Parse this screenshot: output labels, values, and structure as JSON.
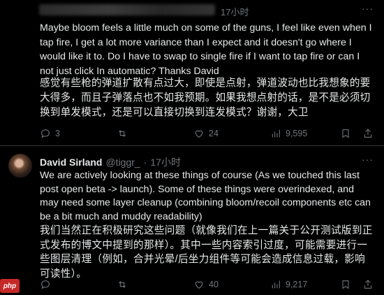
{
  "post1": {
    "time": "17小时",
    "more_icon": "more-icon",
    "text_en": "Maybe bloom feels a little much on some of the guns, I feel like even when I tap fire, I get a lot more variance than I expect and it doesn't go where I would like it to. Do I have to swap to single fire if I want to tap fire or can I not just click   In automatic? Thanks David",
    "text_zh": "感觉有些枪的弹道扩散有点过大，即使是点射，弹道波动也比我想象的要大得多，而且子弹落点也不如我预期。如果我想点射的话，是不是必须切换到单发模式，还是可以直接切换到连发模式？谢谢，大卫",
    "actions": {
      "reply_count": "3",
      "repost_count": "",
      "like_count": "24",
      "views_count": "9,595"
    }
  },
  "post2": {
    "author_name": "David Sirland",
    "author_handle": "@tiggr_",
    "separator": "·",
    "time": "17小时",
    "text_en": "We are actively looking at these things of course (As we touched this last post open beta -> launch). Some of these things were overindexed, and may need some layer cleanup (combining bloom/recoil components etc can be a bit much and muddy readability)",
    "text_zh": "我们当然正在积极研究这些问题（就像我们在上一篇关于公开测试版到正式发布的博文中提到的那样）。其中一些内容索引过度，可能需要进行一些图层清理（例如，合并光晕/后坐力组件等可能会造成信息过载，影响可读性）。",
    "actions": {
      "reply_count": "",
      "repost_count": "",
      "like_count": "40",
      "views_count": "9,217"
    }
  },
  "watermark": {
    "logo_text": "php"
  },
  "colors": {
    "background": "#000000",
    "text": "#e7e9ea",
    "muted": "#71767b",
    "divider": "#2f3336"
  }
}
